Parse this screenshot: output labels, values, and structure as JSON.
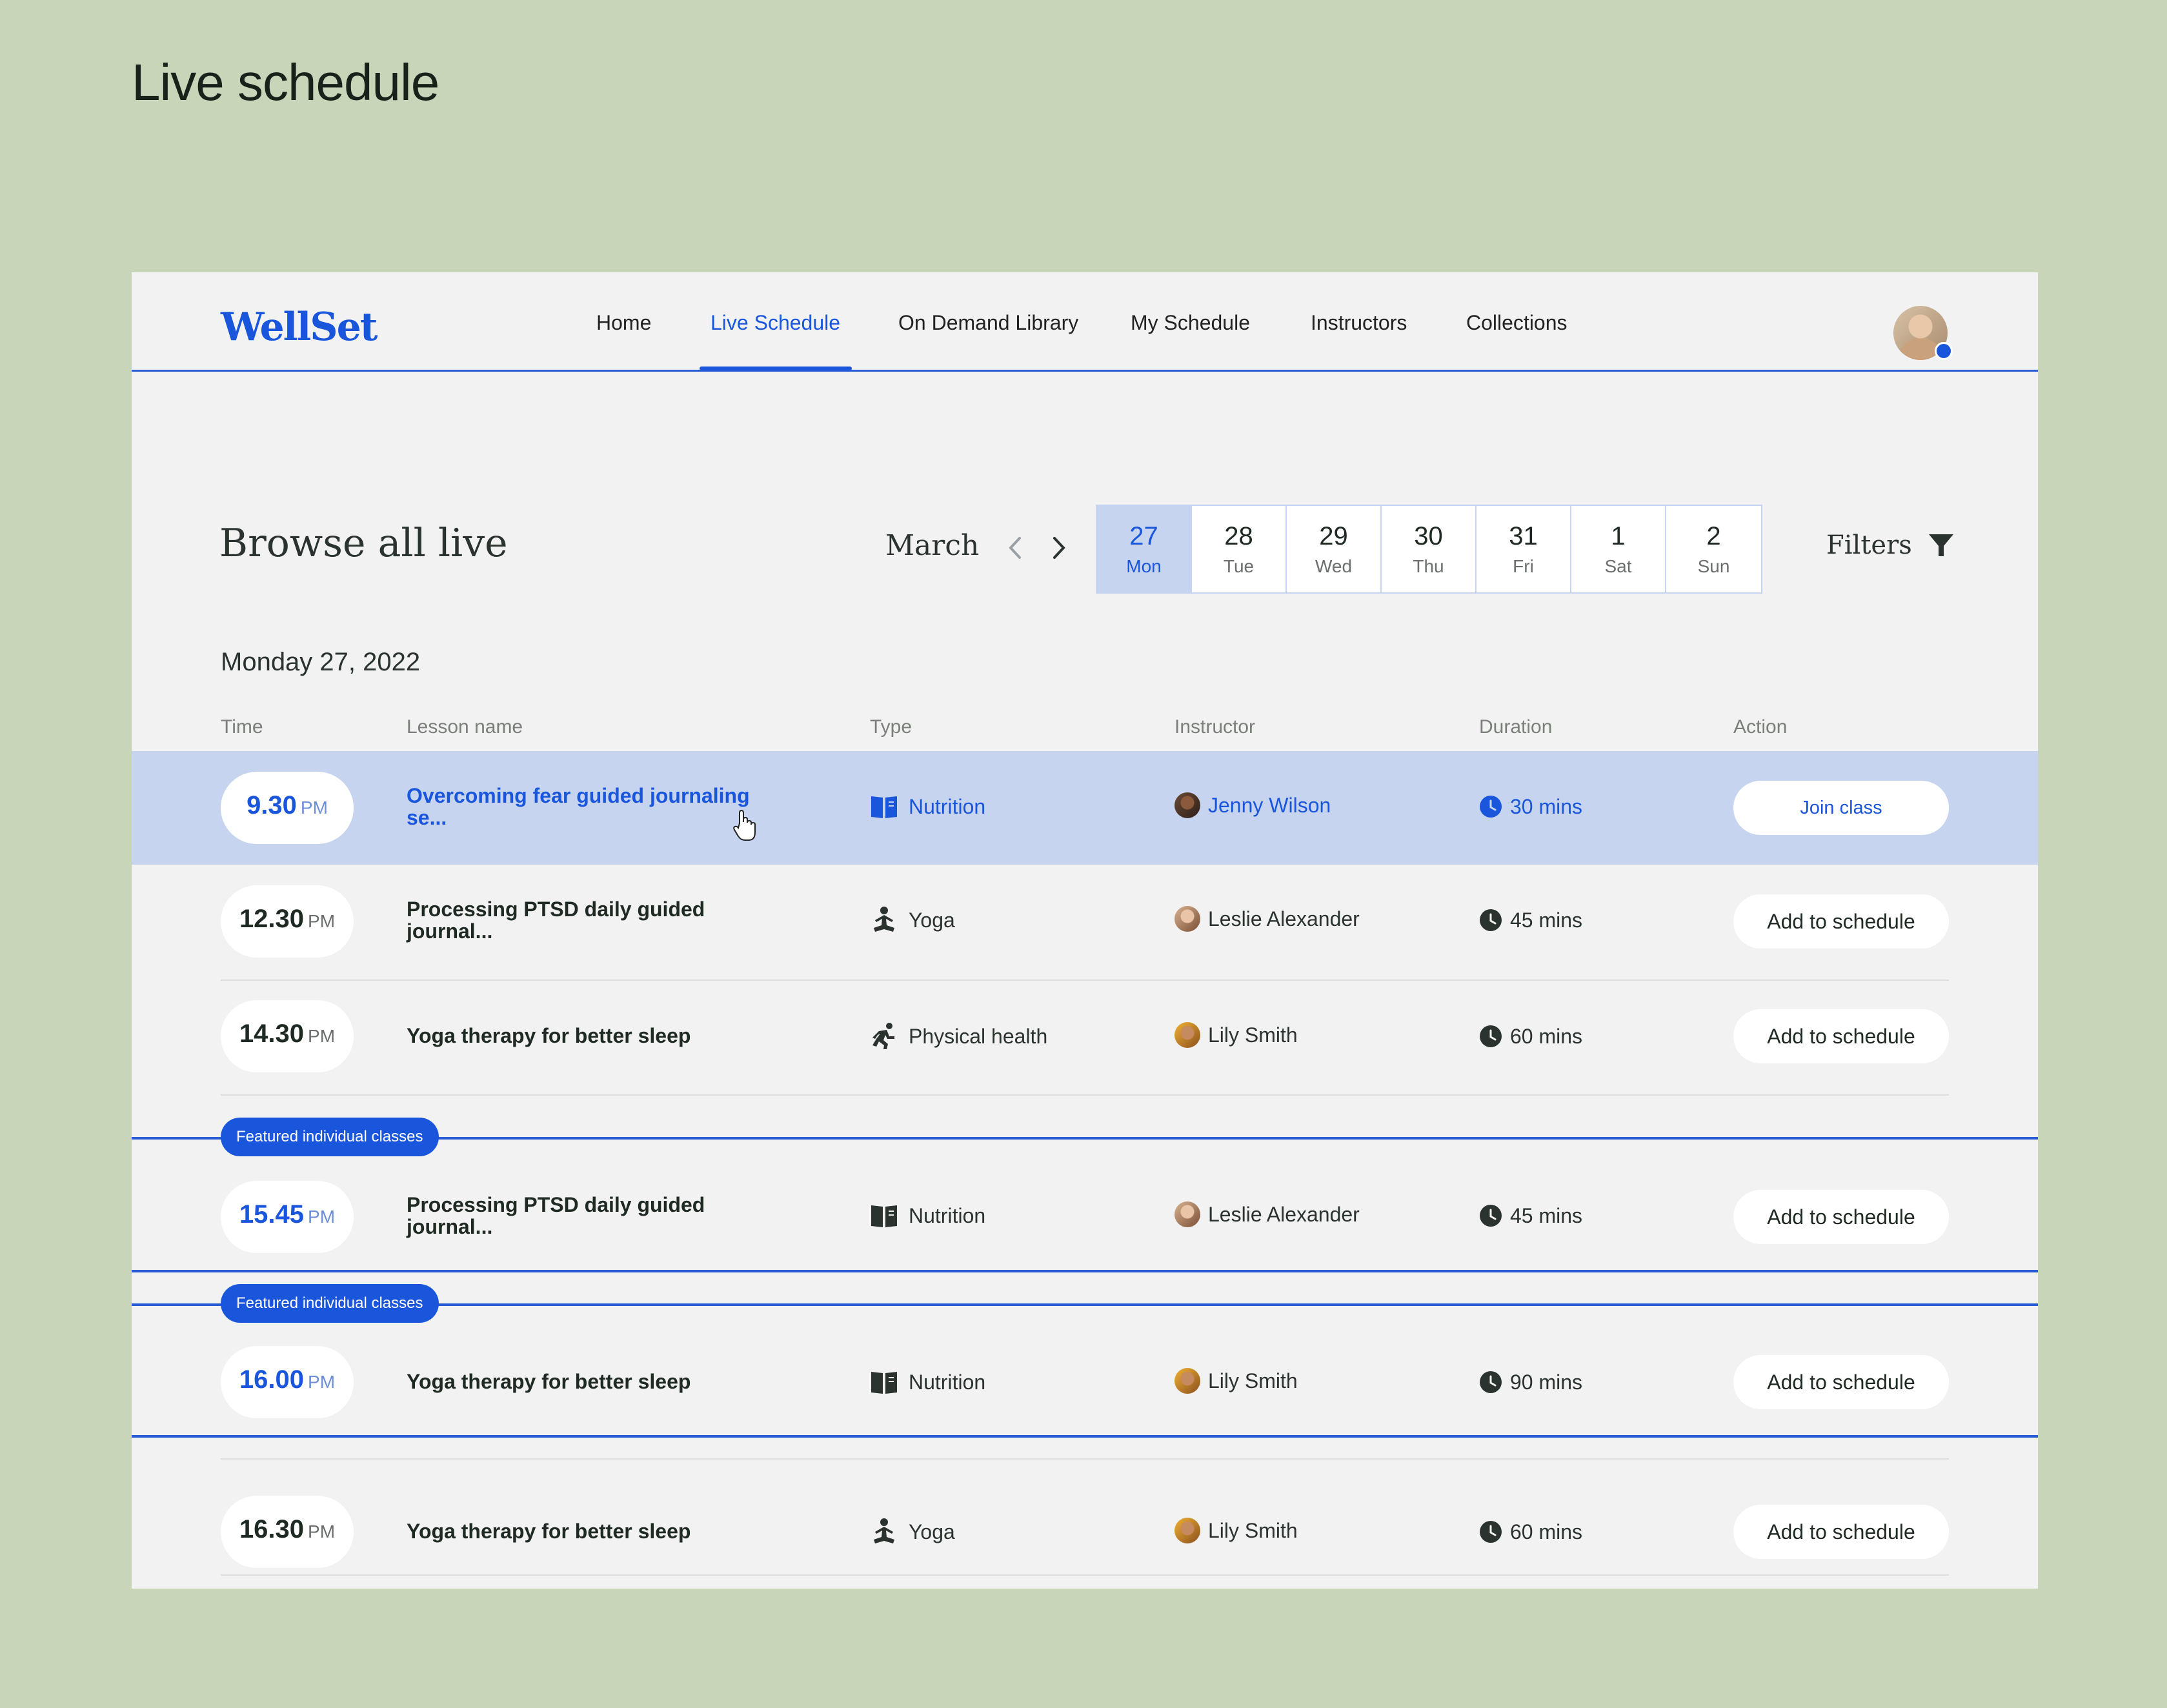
{
  "page_heading": "Live schedule",
  "nav": {
    "logo": "WellSet",
    "items": [
      {
        "label": "Home"
      },
      {
        "label": "Live Schedule"
      },
      {
        "label": "On Demand Library"
      },
      {
        "label": "My Schedule"
      },
      {
        "label": "Instructors"
      },
      {
        "label": "Collections"
      }
    ],
    "active_index": 1
  },
  "browse": {
    "title": "Browse all live",
    "month": "March",
    "days": [
      {
        "num": "27",
        "dow": "Mon"
      },
      {
        "num": "28",
        "dow": "Tue"
      },
      {
        "num": "29",
        "dow": "Wed"
      },
      {
        "num": "30",
        "dow": "Thu"
      },
      {
        "num": "31",
        "dow": "Fri"
      },
      {
        "num": "1",
        "dow": "Sat"
      },
      {
        "num": "2",
        "dow": "Sun"
      }
    ],
    "selected_day_index": 0,
    "filters_label": "Filters"
  },
  "date_heading": "Monday 27, 2022",
  "columns": {
    "time": "Time",
    "lesson": "Lesson name",
    "type": "Type",
    "instructor": "Instructor",
    "duration": "Duration",
    "action": "Action"
  },
  "featured_label": "Featured individual classes",
  "rows": [
    {
      "time": "9.30",
      "ampm": "PM",
      "lesson_l1": "Overcoming fear guided journaling",
      "lesson_l2": "se...",
      "type": "Nutrition",
      "type_icon": "book-icon",
      "instructor": "Jenny Wilson",
      "duration": "30 mins",
      "action": "Join class"
    },
    {
      "time": "12.30",
      "ampm": "PM",
      "lesson_l1": "Processing PTSD daily guided",
      "lesson_l2": "journal...",
      "type": "Yoga",
      "type_icon": "yoga-icon",
      "instructor": "Leslie Alexander",
      "duration": "45 mins",
      "action": "Add to schedule"
    },
    {
      "time": "14.30",
      "ampm": "PM",
      "lesson_l1": "Yoga therapy for better sleep",
      "lesson_l2": "",
      "type": "Physical health",
      "type_icon": "running-icon",
      "instructor": "Lily Smith",
      "duration": "60 mins",
      "action": "Add to schedule"
    },
    {
      "time": "15.45",
      "ampm": "PM",
      "lesson_l1": "Processing PTSD daily guided",
      "lesson_l2": "journal...",
      "type": "Nutrition",
      "type_icon": "book-icon",
      "instructor": "Leslie Alexander",
      "duration": "45 mins",
      "action": "Add to schedule"
    },
    {
      "time": "16.00",
      "ampm": "PM",
      "lesson_l1": "Yoga therapy for better sleep",
      "lesson_l2": "",
      "type": "Nutrition",
      "type_icon": "book-icon",
      "instructor": "Lily Smith",
      "duration": "90 mins",
      "action": "Add to schedule"
    },
    {
      "time": "16.30",
      "ampm": "PM",
      "lesson_l1": "Yoga therapy for better sleep",
      "lesson_l2": "",
      "type": "Yoga",
      "type_icon": "yoga-icon",
      "instructor": "Lily Smith",
      "duration": "60 mins",
      "action": "Add to schedule"
    }
  ],
  "colors": {
    "background": "#c8d5b9",
    "accent": "#1a56db",
    "highlight_row": "#c6d4ef"
  }
}
